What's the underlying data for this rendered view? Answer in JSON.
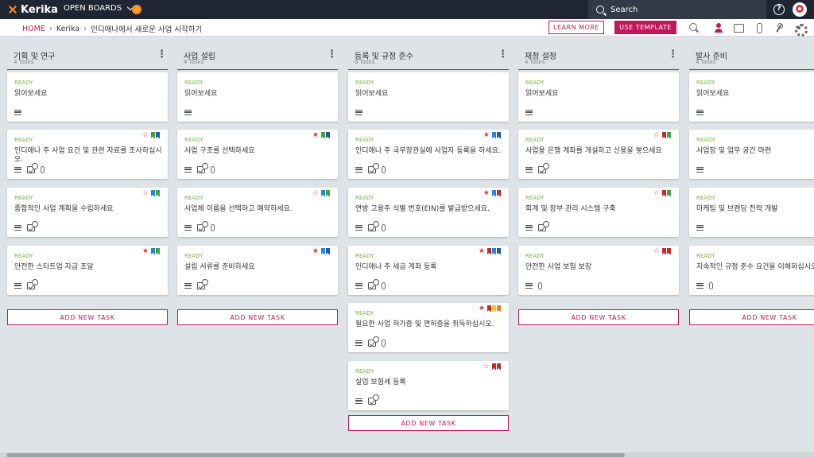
{
  "app": {
    "logo": "Kerika",
    "open_boards": "OPEN BOARDS"
  },
  "search": {
    "placeholder": "Search"
  },
  "help": {
    "label": "?"
  },
  "breadcrumb": {
    "home": "HOME",
    "workspace": "Kerika",
    "board": "인디애나에서 새로운 사업 시작하기"
  },
  "actions": {
    "learn_more": "LEARN MORE",
    "use_template": "USE TEMPLATE"
  },
  "colors": {
    "accent": "#c2185b",
    "status_ready": "#7cb342",
    "topbar": "#1f2532"
  },
  "columns": [
    {
      "title": "기획 및 연구",
      "count": "4 Tasks",
      "add_label": "ADD NEW TASK",
      "cards": [
        {
          "status": "READY",
          "title": "읽어보세요",
          "star": "",
          "flags": [],
          "icons": [
            "desc"
          ]
        },
        {
          "status": "READY",
          "title": "인디애나 주 사업 요건 및 관련 자료를 조사하십시오.",
          "star": "☆",
          "flags": [
            "#43a047",
            "#1e5aa8"
          ],
          "icons": [
            "desc",
            "check",
            "attach"
          ]
        },
        {
          "status": "READY",
          "title": "종합적인 사업 계획을 수립하세요",
          "star": "☆",
          "flags": [
            "#1e88e5",
            "#43a047"
          ],
          "icons": [
            "desc",
            "check"
          ]
        },
        {
          "status": "READY",
          "title": "안전한 스타트업 자금 조달",
          "star": "★",
          "flags": [
            "#1e88e5",
            "#43a047"
          ],
          "icons": [
            "desc",
            "check"
          ]
        }
      ]
    },
    {
      "title": "사업 설립",
      "count": "4 Tasks",
      "add_label": "ADD NEW TASK",
      "cards": [
        {
          "status": "READY",
          "title": "읽어보세요",
          "star": "",
          "flags": [],
          "icons": [
            "desc"
          ]
        },
        {
          "status": "READY",
          "title": "사업 구조를 선택하세요",
          "star": "★",
          "flags": [
            "#43a047",
            "#1e5aa8"
          ],
          "icons": [
            "desc",
            "check",
            "attach"
          ]
        },
        {
          "status": "READY",
          "title": "사업체 이름을 선택하고 예약하세요.",
          "star": "☆",
          "flags": [
            "#1e88e5",
            "#43a047"
          ],
          "icons": [
            "desc",
            "check",
            "attach"
          ]
        },
        {
          "status": "READY",
          "title": "설립 서류를 준비하세요",
          "star": "★",
          "flags": [
            "#1e88e5",
            "#1e5aa8"
          ],
          "icons": [
            "desc",
            "check"
          ]
        }
      ]
    },
    {
      "title": "등록 및 규정 준수",
      "count": "6 Tasks",
      "add_label": "ADD NEW TASK",
      "cards": [
        {
          "status": "READY",
          "title": "읽어보세요",
          "star": "",
          "flags": [],
          "icons": [
            "desc"
          ]
        },
        {
          "status": "READY",
          "title": "인디애나 주 국무장관실에 사업자 등록을 하세요.",
          "star": "★",
          "flags": [
            "#1e88e5",
            "#1e5aa8"
          ],
          "icons": [
            "desc",
            "check",
            "attach"
          ]
        },
        {
          "status": "READY",
          "title": "연방 고용주 식별 번호(EIN)를 발급받으세요.",
          "star": "★",
          "flags": [
            "#1e88e5",
            "#c62828"
          ],
          "icons": [
            "desc",
            "check",
            "attach"
          ]
        },
        {
          "status": "READY",
          "title": "인디애나 주 세금 계좌 등록",
          "star": "★",
          "flags": [
            "#c62828",
            "#1e88e5",
            "#1e5aa8"
          ],
          "icons": [
            "desc",
            "check",
            "attach"
          ]
        },
        {
          "status": "READY",
          "title": "필요한 사업 허가증 및 면허증을 취득하십시오.",
          "star": "★",
          "flags": [
            "#c62828",
            "#fbc02d",
            "#f57c00"
          ],
          "icons": [
            "desc",
            "check",
            "attach"
          ]
        },
        {
          "status": "READY",
          "title": "실업 보험세 등록",
          "star": "☆",
          "flags": [
            "#c62828",
            "#c62828"
          ],
          "icons": [
            "desc",
            "check"
          ]
        }
      ]
    },
    {
      "title": "재정 설정",
      "count": "4 Tasks",
      "add_label": "ADD NEW TASK",
      "cards": [
        {
          "status": "READY",
          "title": "읽어보세요",
          "star": "",
          "flags": [],
          "icons": [
            "desc"
          ]
        },
        {
          "status": "READY",
          "title": "사업용 은행 계좌를 개설하고 신용을 쌓으세요",
          "star": "☆",
          "flags": [
            "#c62828",
            "#43a047"
          ],
          "icons": [
            "desc",
            "check"
          ]
        },
        {
          "status": "READY",
          "title": "회계 및 장부 관리 시스템 구축",
          "star": "☆",
          "flags": [
            "#c62828",
            "#43a047"
          ],
          "icons": [
            "desc",
            "check"
          ]
        },
        {
          "status": "READY",
          "title": "안전한 사업 보험 보장",
          "star": "☆",
          "flags": [
            "#c62828",
            "#c62828"
          ],
          "icons": [
            "desc",
            "attach"
          ]
        }
      ]
    },
    {
      "title": "발사 준비",
      "count": "4 Tasks",
      "add_label": "ADD NEW TASK",
      "cards": [
        {
          "status": "READY",
          "title": "읽어보세요",
          "star": "",
          "flags": [],
          "icons": [
            "desc"
          ]
        },
        {
          "status": "READY",
          "title": "사업장 및 업무 공간 마련",
          "star": "",
          "flags": [],
          "icons": [
            "desc"
          ]
        },
        {
          "status": "READY",
          "title": "마케팅 및 브랜딩 전략 개발",
          "star": "",
          "flags": [],
          "icons": [
            "desc"
          ]
        },
        {
          "status": "READY",
          "title": "지속적인 규정 준수 요건을 이해하십시오",
          "star": "",
          "flags": [],
          "icons": [
            "desc",
            "attach"
          ]
        }
      ]
    }
  ]
}
